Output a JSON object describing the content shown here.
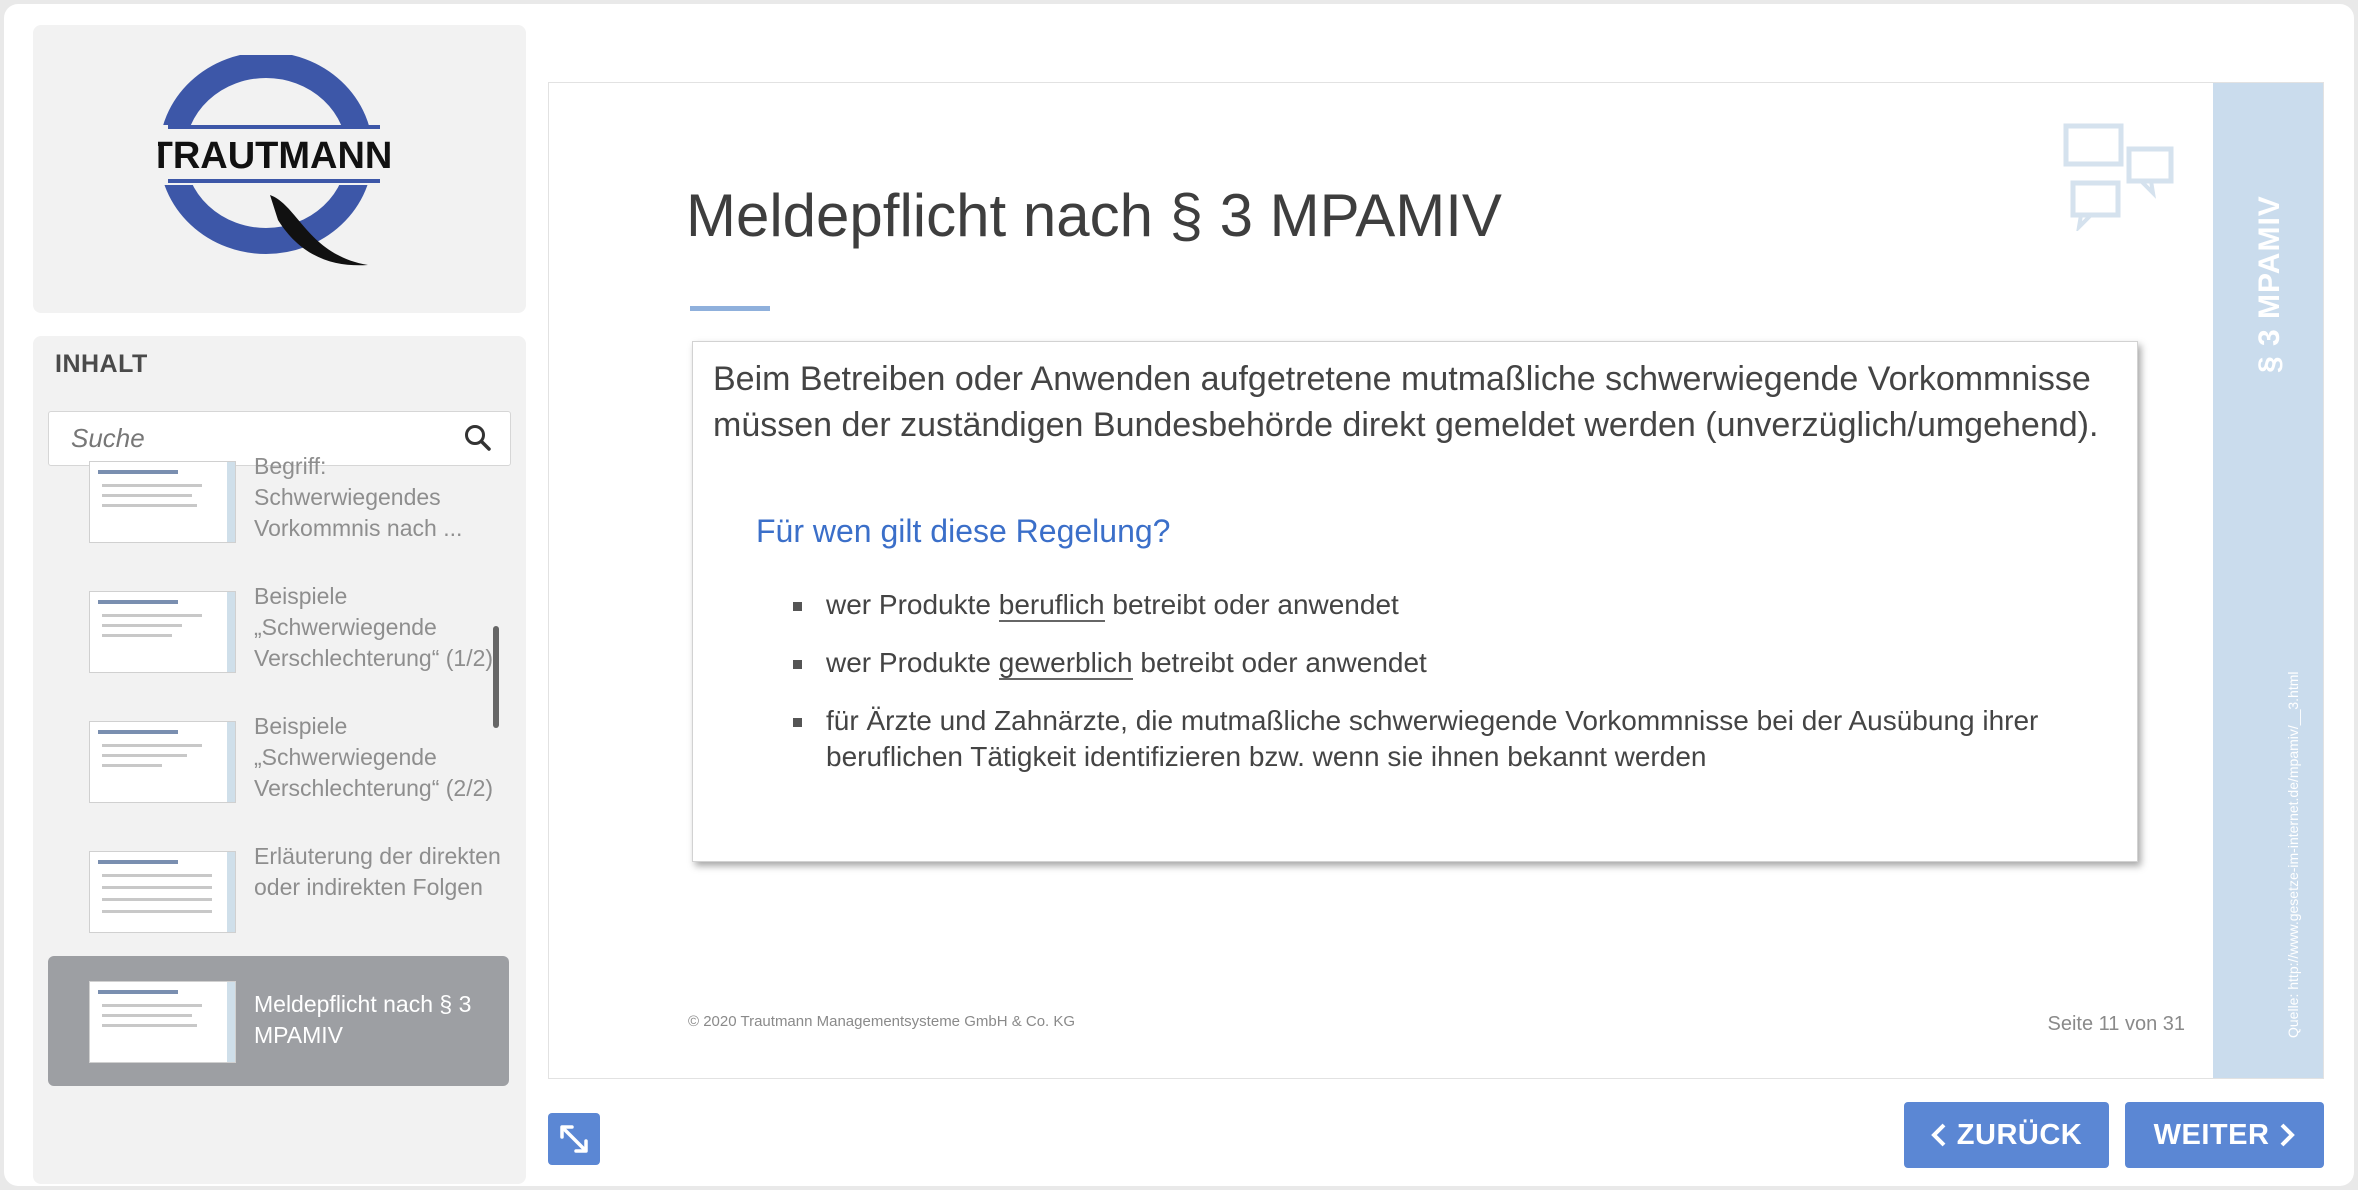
{
  "logo": {
    "text": "TRAUTMANN"
  },
  "sidebar": {
    "heading": "INHALT",
    "search_placeholder": "Suche",
    "items": [
      {
        "label": "Begriff: Schwerwiegendes Vorkommnis nach ...",
        "active": false
      },
      {
        "label": "Beispiele „Schwerwiegende Verschlechterung“ (1/2)",
        "active": false
      },
      {
        "label": "Beispiele „Schwerwiegende Verschlechterung“ (2/2)",
        "active": false
      },
      {
        "label": "Erläuterung der direkten oder indirekten Folgen",
        "active": false
      },
      {
        "label": "Meldepflicht nach § 3 MPAMIV",
        "active": true
      }
    ]
  },
  "slide": {
    "title": "Meldepflicht nach § 3 MPAMIV",
    "side_title": "§ 3 MPAMIV",
    "side_source": "Quelle: http://www.gesetze-im-internet.de/mpamiv/__3.html",
    "intro": "Beim Betreiben oder Anwenden aufgetretene mutmaßliche schwerwiegende Vorkommnisse müssen der zuständigen Bundesbehörde direkt gemeldet werden (unverzüglich/umgehend).",
    "question": "Für wen gilt diese Regelung?",
    "bullets": [
      {
        "pre": "wer Produkte ",
        "em": "beruflich",
        "post": " betreibt oder anwendet"
      },
      {
        "pre": "wer Produkte ",
        "em": "gewerblich",
        "post": " betreibt oder anwendet"
      },
      {
        "pre": "für Ärzte und Zahnärzte, die mutmaßliche schwerwiegende Vorkommnisse bei der Ausübung ihrer beruflichen Tätigkeit identifizieren bzw. wenn sie ihnen bekannt werden",
        "em": "",
        "post": ""
      }
    ],
    "copyright": "© 2020 Trautmann Managementsysteme GmbH & Co. KG",
    "page": "Seite 11 von 31"
  },
  "nav": {
    "back_label": "ZURÜCK",
    "next_label": "WEITER"
  },
  "colors": {
    "accent": "#5b87d4",
    "heading_blue": "#3b6fc9",
    "side_band": "#cadced",
    "active_item": "#9d9fa3"
  },
  "icons": [
    "search-icon",
    "chat-bubbles-icon",
    "expand-icon",
    "chevron-left-icon",
    "chevron-right-icon"
  ]
}
